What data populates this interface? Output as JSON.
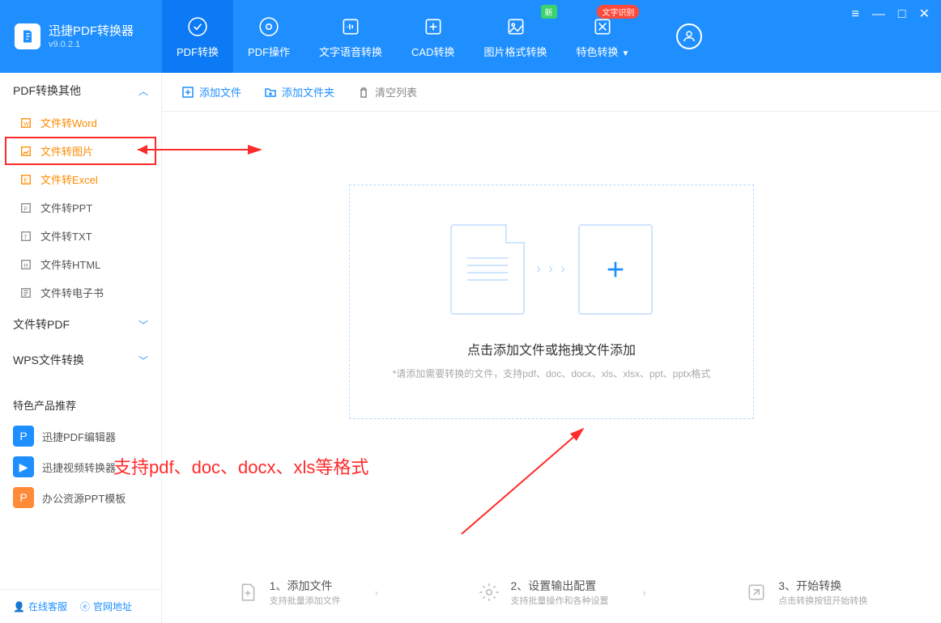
{
  "app": {
    "name": "迅捷PDF转换器",
    "version": "v9.0.2.1"
  },
  "tabs": [
    {
      "label": "PDF转换",
      "active": true
    },
    {
      "label": "PDF操作"
    },
    {
      "label": "文字语音转换"
    },
    {
      "label": "CAD转换"
    },
    {
      "label": "图片格式转换",
      "badge": "新",
      "badge_type": "green"
    },
    {
      "label": "特色转换",
      "badge": "文字识别",
      "badge_type": "red",
      "dropdown": true
    }
  ],
  "sidebar": {
    "groups": [
      {
        "label": "PDF转换其他",
        "expanded": true,
        "items": [
          {
            "label": "文件转Word",
            "orange": true
          },
          {
            "label": "文件转图片",
            "orange": true,
            "highlighted": true
          },
          {
            "label": "文件转Excel",
            "orange": true
          },
          {
            "label": "文件转PPT"
          },
          {
            "label": "文件转TXT"
          },
          {
            "label": "文件转HTML"
          },
          {
            "label": "文件转电子书"
          }
        ]
      },
      {
        "label": "文件转PDF",
        "expanded": false
      },
      {
        "label": "WPS文件转换",
        "expanded": false
      }
    ],
    "promo_title": "特色产品推荐",
    "promos": [
      {
        "label": "迅捷PDF编辑器",
        "color": "blue",
        "glyph": "P"
      },
      {
        "label": "迅捷视频转换器",
        "color": "blue",
        "glyph": "▶"
      },
      {
        "label": "办公资源PPT模板",
        "color": "orange",
        "glyph": "P"
      }
    ],
    "footer": {
      "service": "在线客服",
      "site": "官网地址"
    }
  },
  "toolbar": {
    "add_file": "添加文件",
    "add_folder": "添加文件夹",
    "clear": "清空列表"
  },
  "dropzone": {
    "title": "点击添加文件或拖拽文件添加",
    "hint": "*请添加需要转换的文件，支持pdf、doc、docx、xls、xlsx、ppt、pptx格式",
    "arrows": "› › ›"
  },
  "steps": [
    {
      "t1": "1、添加文件",
      "t2": "支持批量添加文件"
    },
    {
      "t1": "2、设置输出配置",
      "t2": "支持批量操作和各种设置"
    },
    {
      "t1": "3、开始转换",
      "t2": "点击转换按钮开始转换"
    }
  ],
  "annotations": {
    "a1": "支持pdf、doc、docx、xls等格式"
  }
}
